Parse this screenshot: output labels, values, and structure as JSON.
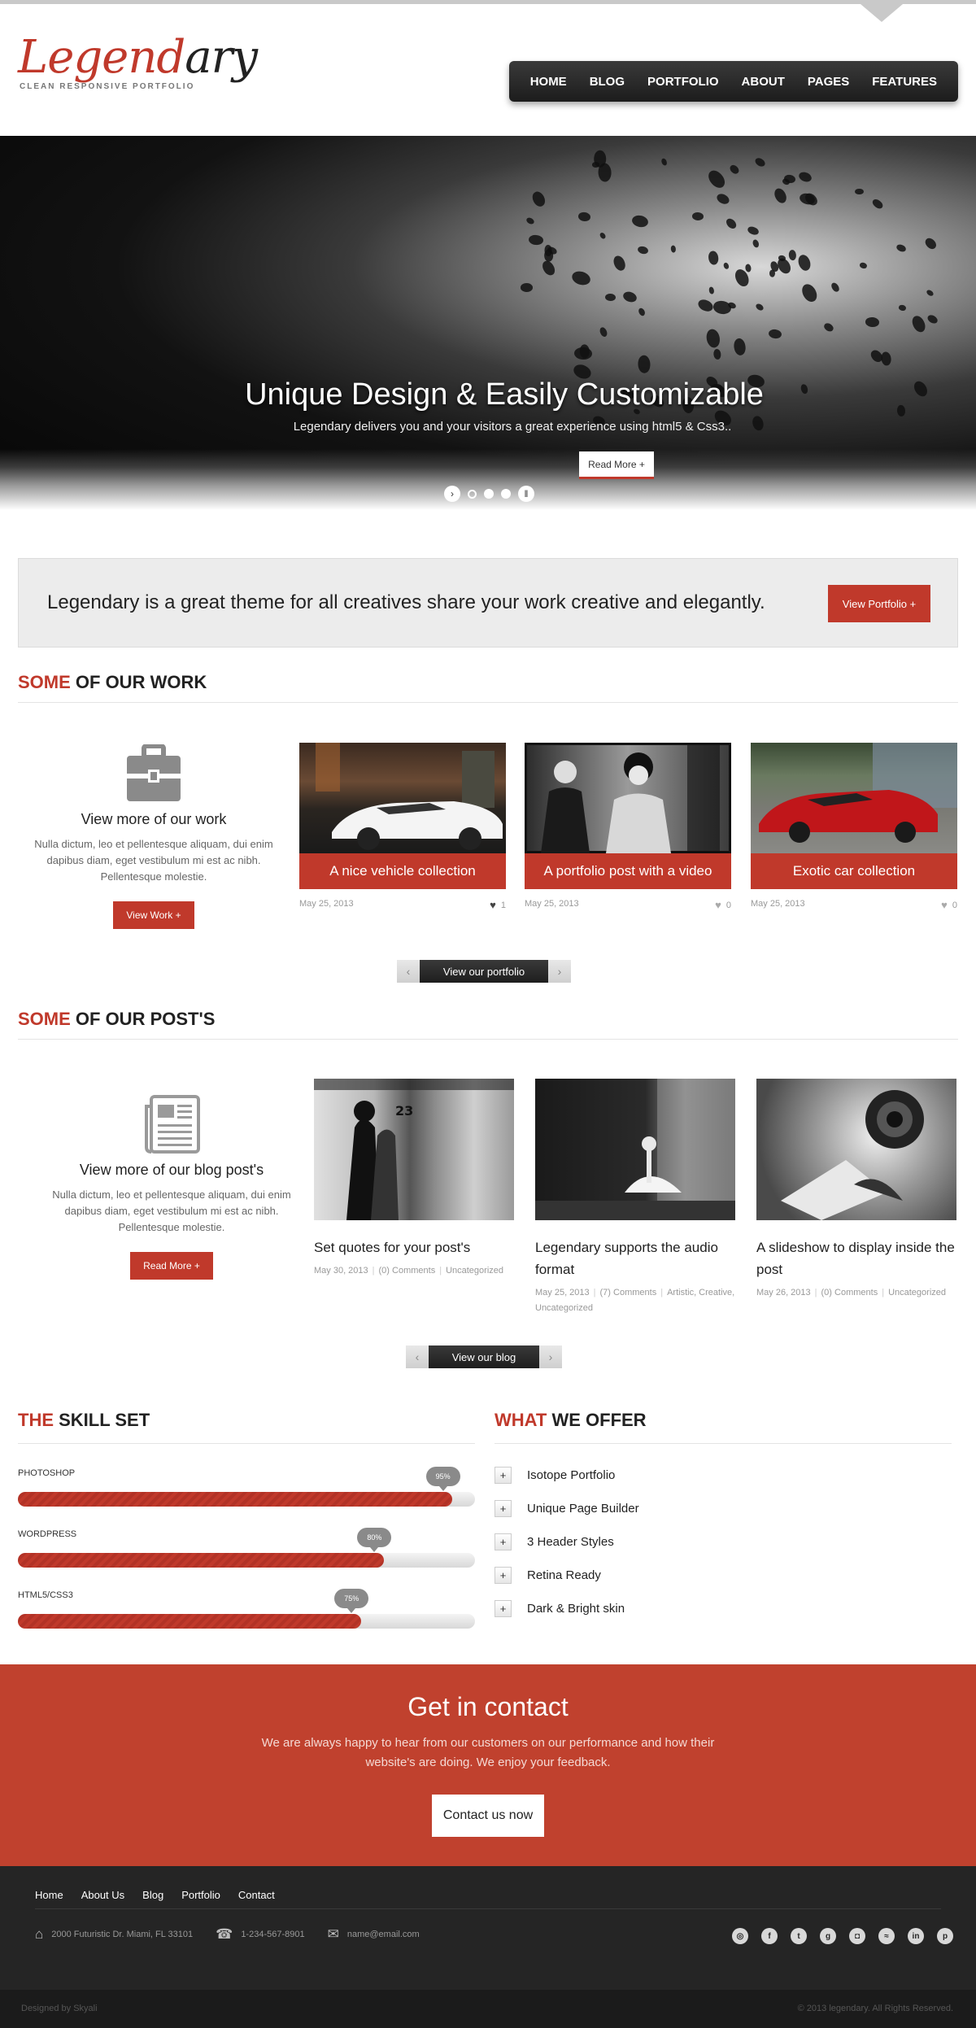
{
  "logo": {
    "part1": "Legend",
    "part2": "ary",
    "tagline": "CLEAN RESPONSIVE PORTFOLIO"
  },
  "nav": [
    "HOME",
    "BLOG",
    "PORTFOLIO",
    "ABOUT",
    "PAGES",
    "FEATURES"
  ],
  "hero": {
    "title": "Unique Design & Easily Customizable",
    "subtitle": "Legendary delivers you and your visitors a great experience using html5 & Css3..",
    "button": "Read More +"
  },
  "callout": {
    "text": "Legendary is a great theme for all creatives share your work creative and elegantly.",
    "button": "View Portfolio +"
  },
  "work": {
    "title_red": "SOME",
    "title_rest": " OF OUR WORK",
    "intro_title": "View more of our work",
    "intro_desc": "Nulla dictum, leo et pellentesque aliquam, dui enim dapibus diam, eget vestibulum mi est ac nibh. Pellentesque molestie.",
    "intro_button": "View Work +",
    "items": [
      {
        "caption": "A nice vehicle collection",
        "date": "May 25, 2013",
        "likes": "1"
      },
      {
        "caption": "A portfolio post with a video",
        "date": "May 25, 2013",
        "likes": "0"
      },
      {
        "caption": "Exotic car collection",
        "date": "May 25, 2013",
        "likes": "0"
      }
    ],
    "pager": "View our portfolio"
  },
  "posts": {
    "title_red": "SOME",
    "title_rest": " OF OUR POST'S",
    "intro_title": "View more of our blog post's",
    "intro_desc": "Nulla dictum, leo et pellentesque aliquam, dui enim dapibus diam, eget vestibulum mi est ac nibh. Pellentesque molestie.",
    "intro_button": "Read More +",
    "items": [
      {
        "title": "Set quotes for your post's",
        "date": "May 30, 2013",
        "comments": "(0) Comments",
        "cats": "Uncategorized"
      },
      {
        "title": "Legendary supports the audio format",
        "date": "May 25, 2013",
        "comments": "(7) Comments",
        "cats": "Artistic, Creative, Uncategorized"
      },
      {
        "title": "A slideshow to display inside the post",
        "date": "May 26, 2013",
        "comments": "(0) Comments",
        "cats": "Uncategorized"
      }
    ],
    "pager": "View our blog"
  },
  "skills": {
    "title_red": "THE",
    "title_rest": " SKILL SET",
    "items": [
      {
        "name": "PHOTOSHOP",
        "percent": 95,
        "label": "95%"
      },
      {
        "name": "WORDPRESS",
        "percent": 80,
        "label": "80%"
      },
      {
        "name": "HTML5/CSS3",
        "percent": 75,
        "label": "75%"
      }
    ]
  },
  "offer": {
    "title_red": "WHAT",
    "title_rest": " WE OFFER",
    "items": [
      "Isotope Portfolio",
      "Unique Page Builder",
      "3 Header Styles",
      "Retina Ready",
      "Dark & Bright skin"
    ]
  },
  "contact": {
    "title": "Get in contact",
    "desc": "We are always happy to hear from our customers on our performance and how their website's are doing. We enjoy your feedback.",
    "button": "Contact us now"
  },
  "footer": {
    "links": [
      "Home",
      "About Us",
      "Blog",
      "Portfolio",
      "Contact"
    ],
    "address": "2000 Futuristic Dr. Miami, FL 33101",
    "phone": "1-234-567-8901",
    "email": "name@email.com",
    "social": [
      "dribbble-icon",
      "facebook-icon",
      "twitter-icon",
      "googleplus-icon",
      "instagram-icon",
      "rss-icon",
      "linkedin-icon",
      "pinterest-icon"
    ],
    "designed_by": "Designed by Skyali",
    "copyright": "© 2013 legendary. All Rights Reserved."
  },
  "colors": {
    "accent": "#c0392b",
    "dark": "#252525"
  }
}
